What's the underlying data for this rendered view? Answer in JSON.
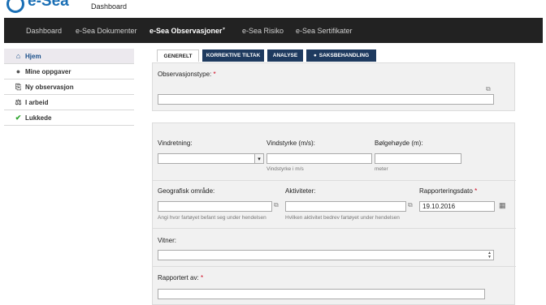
{
  "app": {
    "logo_text": "e-Sea",
    "subtitle": "Dashboard"
  },
  "nav": {
    "items": [
      "Dashboard",
      "e-Sea Dokumenter",
      "e-Sea Observasjoner",
      "e-Sea Risiko",
      "e-Sea Sertifikater"
    ],
    "active": "e-Sea Observasjoner",
    "caret": "▾"
  },
  "sidebar": {
    "items": [
      {
        "label": "Hjem",
        "icon": "home-icon",
        "glyph": "⌂"
      },
      {
        "label": "Mine oppgaver",
        "icon": "speech-bubble-icon",
        "glyph": "●"
      },
      {
        "label": "Ny observasjon",
        "icon": "new-document-icon",
        "glyph": "⎘"
      },
      {
        "label": "I arbeid",
        "icon": "scale-icon",
        "glyph": "⚖"
      },
      {
        "label": "Lukkede",
        "icon": "checkmark-icon",
        "glyph": "✔"
      }
    ]
  },
  "tabs": [
    "GENERELT",
    "KORREKTIVE TILTAK",
    "ANALYSE",
    "SAKSBEHANDLING"
  ],
  "form": {
    "observasjonstype_label": "Observasjonstype:",
    "observasjonstype_value": "",
    "vindretning_label": "Vindretning:",
    "vindretning_value": "",
    "vindstyrke_label": "Vindstyrke (m/s):",
    "vindstyrke_value": "",
    "vindstyrke_hint": "Vindstyrke i m/s",
    "bolgehoyde_label": "Bølgehøyde (m):",
    "bolgehoyde_value": "",
    "bolgehoyde_hint": "meter",
    "geografisk_label": "Geografisk område:",
    "geografisk_value": "",
    "geografisk_hint": "Angi hvor fartøyet befant seg under hendelsen",
    "aktiviteter_label": "Aktiviteter:",
    "aktiviteter_value": "",
    "aktiviteter_hint": "Hvilken aktivitet bedrev fartøyet under hendelsen",
    "rapporteringsdato_label": "Rapporteringsdato",
    "rapporteringsdato_value": "19.10.2016",
    "vitner_label": "Vitner:",
    "vitner_value": "",
    "rapportert_label": "Rapportert av:",
    "rapportert_value": "",
    "required_marker": "*"
  },
  "colors": {
    "navbar_bg": "#222222",
    "brand_blue": "#1a6fb5",
    "tab_dark": "#1e3a5f",
    "required_red": "#d0021b",
    "sidebar_active_bg": "#ece9ee"
  }
}
